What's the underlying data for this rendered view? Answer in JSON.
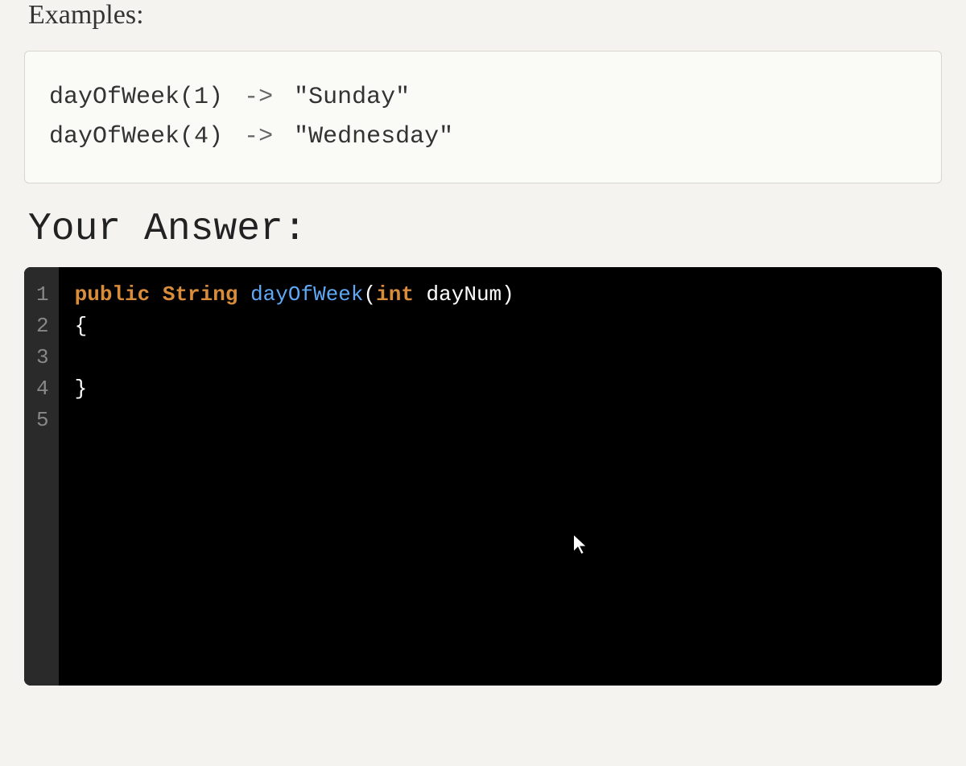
{
  "labels": {
    "examples": "Examples:",
    "your_answer": "Your Answer:"
  },
  "examples": [
    {
      "call": "dayOfWeek(1)",
      "arrow": "->",
      "result": "\"Sunday\""
    },
    {
      "call": "dayOfWeek(4)",
      "arrow": "->",
      "result": "\"Wednesday\""
    }
  ],
  "editor": {
    "gutter": [
      "1",
      "2",
      "3",
      "4",
      "5"
    ],
    "code": {
      "line1": {
        "public": "public",
        "space1": " ",
        "type": "String",
        "space2": " ",
        "method": "dayOfWeek",
        "open_paren": "(",
        "param_type": "int",
        "space3": " ",
        "param_name": "dayNum",
        "close_paren": ")"
      },
      "line2": "{",
      "line3": "",
      "line4": "}",
      "line5": ""
    }
  }
}
